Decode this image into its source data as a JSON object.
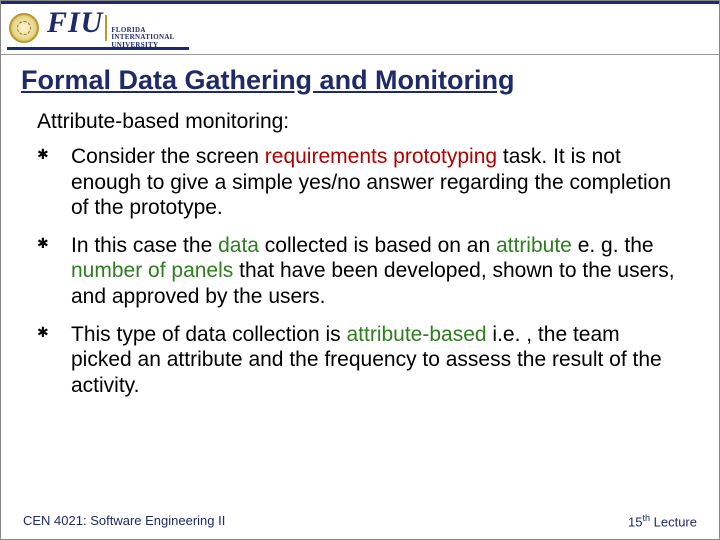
{
  "header": {
    "logo_main": "FIU",
    "logo_sub1": "FLORIDA",
    "logo_sub2": "INTERNATIONAL",
    "logo_sub3": "UNIVERSITY"
  },
  "title": "Formal Data Gathering and Monitoring",
  "lead": "Attribute-based monitoring:",
  "bullets": [
    {
      "segments": [
        {
          "t": "Consider the screen ",
          "c": ""
        },
        {
          "t": "requirements prototyping",
          "c": "hl-red"
        },
        {
          "t": " task. It is not enough to give a simple yes/no answer regarding the completion of the prototype.",
          "c": ""
        }
      ]
    },
    {
      "segments": [
        {
          "t": "In this case the ",
          "c": ""
        },
        {
          "t": "data",
          "c": "hl-green"
        },
        {
          "t": " collected is based on an ",
          "c": ""
        },
        {
          "t": "attribute",
          "c": "hl-green"
        },
        {
          "t": " e. g. the ",
          "c": ""
        },
        {
          "t": "number of panels",
          "c": "hl-green"
        },
        {
          "t": " that have been developed, shown to the users, and approved by the users.",
          "c": ""
        }
      ]
    },
    {
      "segments": [
        {
          "t": "This type of data collection is ",
          "c": ""
        },
        {
          "t": "attribute-based",
          "c": "hl-green"
        },
        {
          "t": " i.e. , the team picked an attribute and the frequency to assess the result of the activity.",
          "c": ""
        }
      ]
    }
  ],
  "footer": {
    "left": "CEN 4021: Software Engineering II",
    "right_num": "15",
    "right_ord": "th",
    "right_word": " Lecture"
  }
}
